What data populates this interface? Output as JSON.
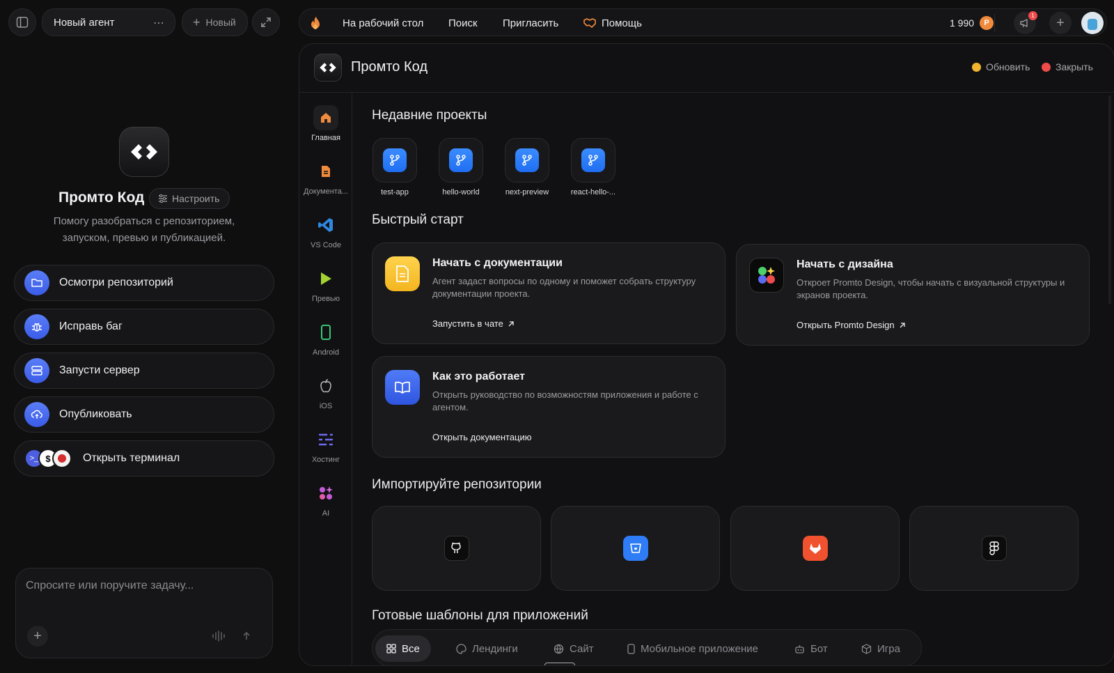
{
  "window": {
    "agent_title": "Новый агент",
    "new_label": "Новый"
  },
  "topbar": {
    "nav": [
      "На рабочий стол",
      "Поиск",
      "Пригласить",
      "Помощь"
    ],
    "balance": "1 990",
    "notif_count": "1"
  },
  "agent": {
    "name": "Промто Код",
    "configure_label": "Настроить",
    "description_line1": "Помогу разобраться с репозиторием,",
    "description_line2": "запуском, превью и публикацией.",
    "quick_actions": [
      "Осмотри репозиторий",
      "Исправь баг",
      "Запусти сервер",
      "Опубликовать",
      "Открыть терминал"
    ],
    "composer_placeholder": "Спросите или поручите задачу..."
  },
  "main": {
    "title": "Промто Код",
    "refresh_label": "Обновить",
    "close_label": "Закрыть",
    "rail": [
      "Главная",
      "Документа...",
      "VS Code",
      "Превью",
      "Android",
      "iOS",
      "Хостинг",
      "AI"
    ],
    "recent_title": "Недавние проекты",
    "recent_projects": [
      "test-app",
      "hello-world",
      "next-preview",
      "react-hello-..."
    ],
    "quickstart_title": "Быстрый старт",
    "cards": [
      {
        "title": "Начать с документации",
        "desc": "Агент задаст вопросы по одному и поможет собрать структуру документации проекта.",
        "link": "Запустить в чате"
      },
      {
        "title": "Начать с дизайна",
        "desc": "Откроет Promto Design, чтобы начать с визуальной структуры и экранов проекта.",
        "link": "Открыть Promto Design"
      },
      {
        "title": "Как это работает",
        "desc": "Открыть руководство по возможностям приложения и работе с агентом.",
        "link": "Открыть документацию"
      }
    ],
    "import_title": "Импортируйте репозитории",
    "import_sources": [
      "github-icon",
      "bitbucket-icon",
      "gitlab-icon",
      "figma-icon"
    ],
    "templates_title": "Готовые шаблоны для приложений",
    "template_tabs": [
      "Все",
      "Лендинги",
      "Сайт",
      "Мобильное приложение",
      "Бот",
      "Игра"
    ]
  },
  "colors": {
    "accent_blue": "#3a5ce8",
    "orange": "#f08a3c",
    "refresh_dot": "#f2b52f",
    "close_dot": "#ef4b4b"
  }
}
